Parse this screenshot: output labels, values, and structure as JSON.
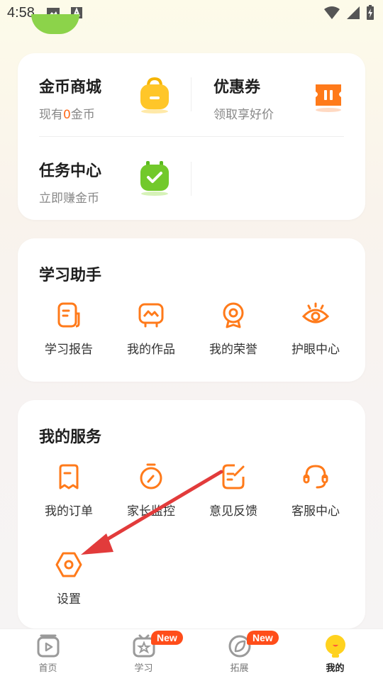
{
  "status_bar": {
    "time": "4:58"
  },
  "coins_card": {
    "shop": {
      "title": "金币商城",
      "sub_prefix": "现有",
      "coin_count": "0",
      "sub_suffix": "金币"
    },
    "coupon": {
      "title": "优惠券",
      "sub": "领取享好价"
    },
    "tasks": {
      "title": "任务中心",
      "sub": "立即赚金币"
    }
  },
  "helper": {
    "title": "学习助手",
    "items": [
      {
        "label": "学习报告",
        "icon": "report-icon"
      },
      {
        "label": "我的作品",
        "icon": "works-icon"
      },
      {
        "label": "我的荣誉",
        "icon": "honor-icon"
      },
      {
        "label": "护眼中心",
        "icon": "eye-icon"
      }
    ]
  },
  "service": {
    "title": "我的服务",
    "items": [
      {
        "label": "我的订单",
        "icon": "order-icon"
      },
      {
        "label": "家长监控",
        "icon": "timer-icon"
      },
      {
        "label": "意见反馈",
        "icon": "feedback-icon"
      },
      {
        "label": "客服中心",
        "icon": "headset-icon"
      },
      {
        "label": "设置",
        "icon": "settings-icon"
      }
    ]
  },
  "tabbar": {
    "tabs": [
      {
        "label": "首页",
        "icon": "home-icon",
        "badge": ""
      },
      {
        "label": "学习",
        "icon": "study-icon",
        "badge": "New"
      },
      {
        "label": "拓展",
        "icon": "explore-icon",
        "badge": "New"
      },
      {
        "label": "我的",
        "icon": "me-icon",
        "badge": ""
      }
    ],
    "active_tab": "我的"
  },
  "colors": {
    "accent": "#ff7a1a",
    "badge": "#ff4d1a",
    "annotation_arrow": "#e23b3b"
  }
}
